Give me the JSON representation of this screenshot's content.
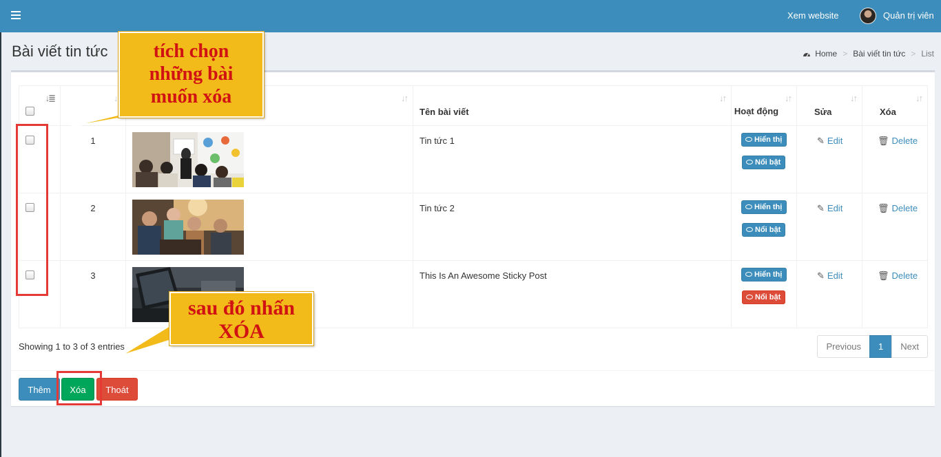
{
  "topbar": {
    "view_website": "Xem website",
    "admin": "Quản trị viên",
    "brand_color": "#3c8dbc"
  },
  "header": {
    "title": "Bài viết tin tức",
    "breadcrumb": [
      "Home",
      "Bài viết tin tức",
      "List"
    ]
  },
  "table": {
    "columns": {
      "title": "Tên bài viết",
      "status": "Hoạt động",
      "edit": "Sửa",
      "delete": "Xóa"
    },
    "rows": [
      {
        "num": "1",
        "title": "Tin tức 1",
        "show": "Hiển thị",
        "featured": "Nổi bật",
        "featured_color": "#3c8dbc",
        "edit": "Edit",
        "delete": "Delete"
      },
      {
        "num": "2",
        "title": "Tin tức 2",
        "show": "Hiển thị",
        "featured": "Nổi bật",
        "featured_color": "#3c8dbc",
        "edit": "Edit",
        "delete": "Delete"
      },
      {
        "num": "3",
        "title": "This Is An Awesome Sticky Post",
        "show": "Hiển thị",
        "featured": "Nổi bật",
        "featured_color": "#dd4b39",
        "edit": "Edit",
        "delete": "Delete"
      }
    ]
  },
  "footer": {
    "info": "Showing 1 to 3 of 3 entries",
    "pagination": {
      "previous": "Previous",
      "current": "1",
      "next": "Next"
    }
  },
  "actions": {
    "add": "Thêm",
    "delete": "Xóa",
    "exit": "Thoát"
  },
  "annotations": {
    "select_note": "tích chọn những bài muốn xóa",
    "delete_note": "sau đó nhấn XÓA",
    "callout_color": "#f3bb1a",
    "highlight_color": "#e53935"
  }
}
